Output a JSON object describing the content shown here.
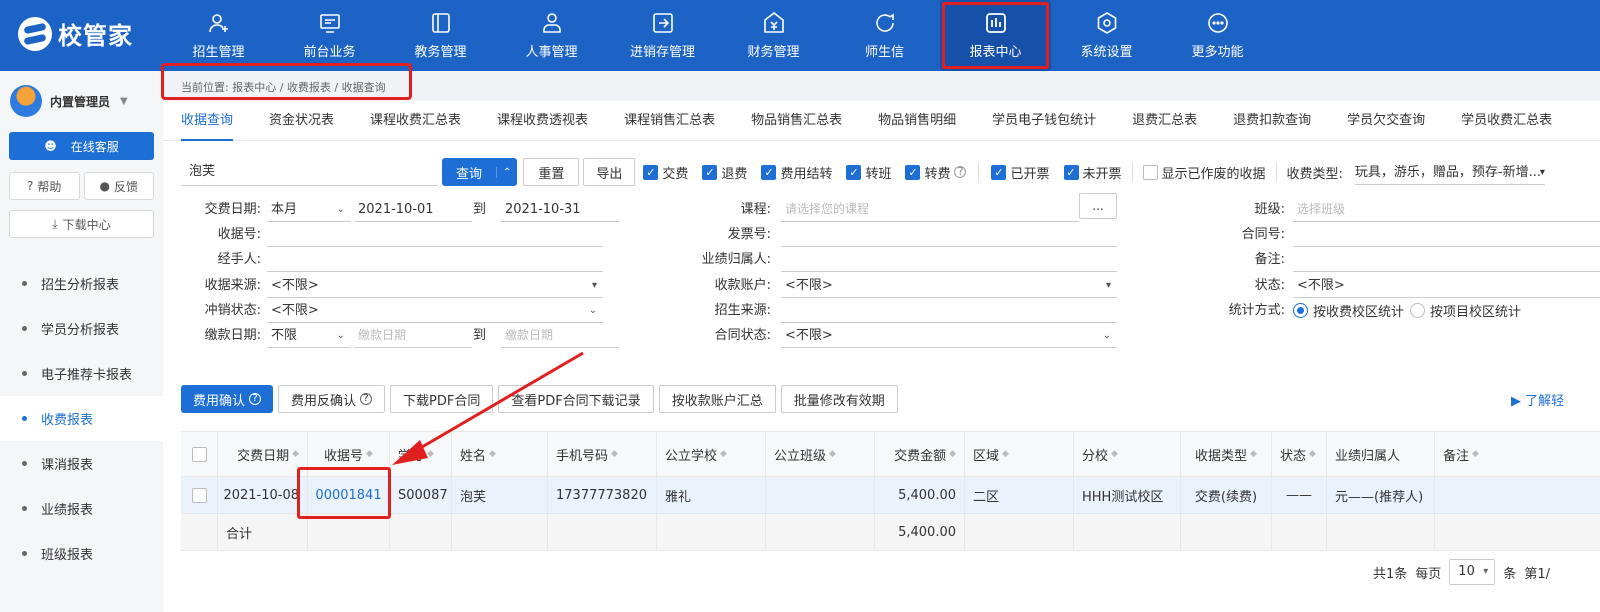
{
  "app": {
    "name": "校管家"
  },
  "nav": [
    {
      "label": "招生管理",
      "icon": "user-add-icon"
    },
    {
      "label": "前台业务",
      "icon": "monitor-icon"
    },
    {
      "label": "教务管理",
      "icon": "book-icon"
    },
    {
      "label": "人事管理",
      "icon": "person-icon"
    },
    {
      "label": "进销存管理",
      "icon": "inventory-icon"
    },
    {
      "label": "财务管理",
      "icon": "finance-icon"
    },
    {
      "label": "师生信",
      "icon": "chat-icon"
    },
    {
      "label": "报表中心",
      "icon": "report-icon"
    },
    {
      "label": "系统设置",
      "icon": "settings-icon"
    },
    {
      "label": "更多功能",
      "icon": "more-icon"
    }
  ],
  "sidebar": {
    "user": "内置管理员",
    "service": "在线客服",
    "help": "帮助",
    "feedback": "反馈",
    "download": "下载中心",
    "items": [
      "招生分析报表",
      "学员分析报表",
      "电子推荐卡报表",
      "收费报表",
      "课消报表",
      "业绩报表",
      "班级报表"
    ]
  },
  "breadcrumb": "当前位置: 报表中心 / 收费报表 / 收据查询",
  "tabs": [
    "收据查询",
    "资金状况表",
    "课程收费汇总表",
    "课程收费透视表",
    "课程销售汇总表",
    "物品销售汇总表",
    "物品销售明细",
    "学员电子钱包统计",
    "退费汇总表",
    "退费扣款查询",
    "学员欠交查询",
    "学员收费汇总表"
  ],
  "search": {
    "keyword": "泡芙",
    "query": "查询",
    "reset": "重置",
    "export": "导出",
    "checks": [
      {
        "label": "交费",
        "on": true
      },
      {
        "label": "退费",
        "on": true
      },
      {
        "label": "费用结转",
        "on": true
      },
      {
        "label": "转班",
        "on": true
      },
      {
        "label": "转费",
        "on": true
      }
    ],
    "checks2": [
      {
        "label": "已开票",
        "on": true
      },
      {
        "label": "未开票",
        "on": true
      }
    ],
    "show_void": "显示已作废的收据",
    "receipt_type_label": "收费类型:",
    "receipt_type_value": "玩具，游乐，赠品，预存-新增..."
  },
  "form": {
    "pay_date_label": "交费日期:",
    "pay_date_period": "本月",
    "pay_date_from": "2021-10-01",
    "to": "到",
    "pay_date_to": "2021-10-31",
    "receipt_no_label": "收据号:",
    "handler_label": "经手人:",
    "source_label": "收据来源:",
    "source_value": "<不限>",
    "writeoff_label": "冲销状态:",
    "writeoff_value": "<不限>",
    "paydate2_label": "缴款日期:",
    "paydate2_value": "不限",
    "paydate2_ph": "缴款日期",
    "course_label": "课程:",
    "course_ph": "请选择您的课程",
    "course_btn": "...",
    "invoice_label": "发票号:",
    "perf_label": "业绩归属人:",
    "account_label": "收款账户:",
    "account_value": "<不限>",
    "enroll_source_label": "招生来源:",
    "contract_status_label": "合同状态:",
    "contract_status_value": "<不限>",
    "class_label": "班级:",
    "class_ph": "选择班级",
    "contract_no_label": "合同号:",
    "remark_label": "备注:",
    "status_label": "状态:",
    "status_value": "<不限>",
    "stat_label": "统计方式:",
    "stat_opt1": "按收费校区统计",
    "stat_opt2": "按项目校区统计"
  },
  "actions": {
    "confirm": "费用确认",
    "unconfirm": "费用反确认",
    "download_pdf": "下载PDF合同",
    "view_pdf_log": "查看PDF合同下载记录",
    "by_account": "按收款账户汇总",
    "batch_edit": "批量修改有效期",
    "learn_more": "了解轻"
  },
  "table": {
    "headers": [
      "交费日期",
      "收据号",
      "学号",
      "姓名",
      "手机号码",
      "公立学校",
      "公立班级",
      "交费金额",
      "区域",
      "分校",
      "收据类型",
      "状态",
      "业绩归属人",
      "备注"
    ],
    "rows": [
      [
        "2021-10-08",
        "00001841",
        "S00087",
        "泡芙",
        "17377773820",
        "雅礼",
        "",
        "5,400.00",
        "二区",
        "HHH测试校区",
        "交费(续费)",
        "——",
        "元——(推荐人)",
        ""
      ]
    ],
    "total_label": "合计",
    "total_amount": "5,400.00"
  },
  "pager": {
    "total": "共1条",
    "per_page": "每页",
    "size": "10",
    "unit": "条",
    "page": "第1/"
  }
}
